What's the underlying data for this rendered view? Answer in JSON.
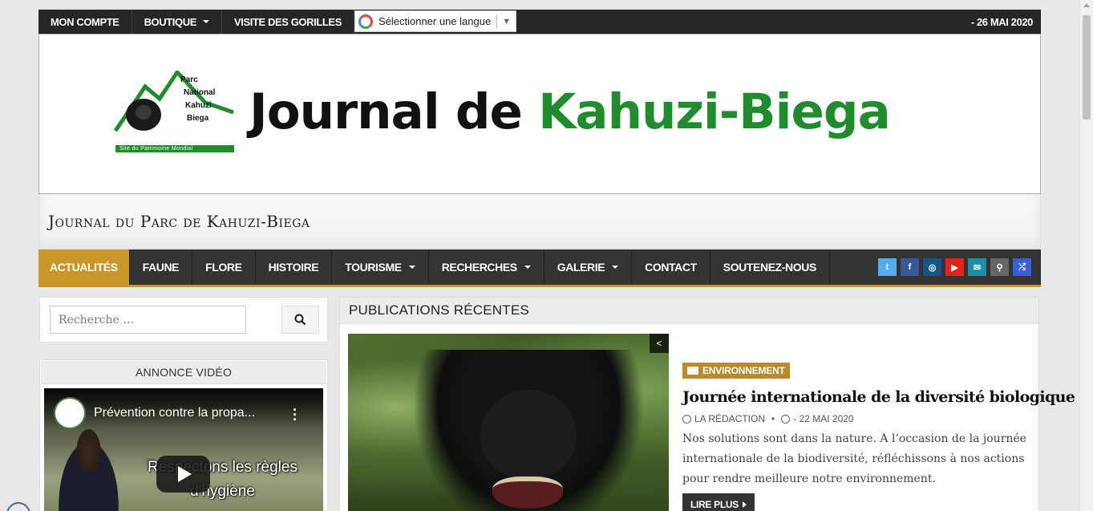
{
  "topbar": {
    "items": [
      {
        "label": "MON COMPTE",
        "has_caret": false
      },
      {
        "label": "BOUTIQUE",
        "has_caret": true
      },
      {
        "label": "VISITE DES GORILLES",
        "has_caret": false
      }
    ],
    "translate_label": "Sélectionner une langue",
    "translate_arrow": "▼",
    "date": "- 26 MAI 2020"
  },
  "banner": {
    "logo_lines": [
      "Parc",
      "National",
      "Kahuzi",
      "Biega"
    ],
    "logo_caption": "Site du Patrimoine Mondial",
    "title_part1": "Journal de",
    "title_part2": "Kahuzi-Biega",
    "title_part2_color": "#218c2d"
  },
  "tagline": "Journal du Parc de Kahuzi-Biega",
  "nav": {
    "items": [
      {
        "label": "ACTUALITÉS",
        "active": true,
        "has_caret": false
      },
      {
        "label": "FAUNE",
        "active": false,
        "has_caret": false
      },
      {
        "label": "FLORE",
        "active": false,
        "has_caret": false
      },
      {
        "label": "HISTOIRE",
        "active": false,
        "has_caret": false
      },
      {
        "label": "TOURISME",
        "active": false,
        "has_caret": true
      },
      {
        "label": "RECHERCHES",
        "active": false,
        "has_caret": true
      },
      {
        "label": "GALERIE",
        "active": false,
        "has_caret": true
      },
      {
        "label": "CONTACT",
        "active": false,
        "has_caret": false
      },
      {
        "label": "SOUTENEZ-NOUS",
        "active": false,
        "has_caret": false
      }
    ],
    "accent_color": "#c9962a",
    "social": [
      {
        "icon": "twitter-icon",
        "glyph": "t",
        "color": "#55acee"
      },
      {
        "icon": "facebook-icon",
        "glyph": "f",
        "color": "#3b5998"
      },
      {
        "icon": "instagram-icon",
        "glyph": "◎",
        "color": "#125688"
      },
      {
        "icon": "youtube-icon",
        "glyph": "▶",
        "color": "#e62117"
      },
      {
        "icon": "email-icon",
        "glyph": "✉",
        "color": "#1a90a6"
      },
      {
        "icon": "search-icon",
        "glyph": "⚲",
        "color": "#666666"
      },
      {
        "icon": "random-icon",
        "glyph": "⤮",
        "color": "#3b5ed6"
      }
    ]
  },
  "sidebar": {
    "search_placeholder": "Recherche …",
    "video_widget_title": "ANNONCE VIDÉO",
    "video_title": "Prévention contre la propa...",
    "video_subtitle_line1": "Respectons les règles",
    "video_subtitle_line2": "d'hygiène"
  },
  "main": {
    "section_title": "PUBLICATIONS RÉCENTES",
    "post": {
      "category": "ENVIRONNEMENT",
      "title": "Journée internationale de la diversité biologique",
      "author": "LA RÉDACTION",
      "date": "- 22 MAI 2020",
      "excerpt": "Nos solutions sont dans la nature. A l’occasion de la journée internationale de la biodiversité, réfléchissons à nos actions pour rendre meilleure notre environnement.",
      "read_more": "LIRE PLUS"
    }
  }
}
